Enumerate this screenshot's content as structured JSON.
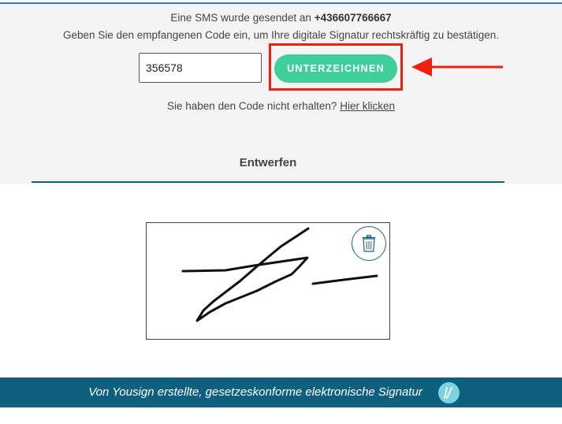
{
  "sms": {
    "sent_prefix": "Eine SMS wurde gesendet an",
    "phone": "+436607766667",
    "instruction": "Geben Sie den empfangenen Code ein, um Ihre digitale Signatur rechtskräftig zu bestätigen.",
    "code_value": "356578",
    "sign_button_label": "UNTERZEICHNEN",
    "resend_prefix": "Sie haben den Code nicht erhalten?",
    "resend_link": "Hier klicken"
  },
  "tabs": {
    "draw_label": "Entwerfen"
  },
  "signature_pad": {
    "clear_icon": "trash-icon"
  },
  "footer": {
    "text": "Von Yousign erstellte, gesetzeskonforme elektronische Signatur",
    "logo_icon": "yousign-logo-icon"
  },
  "colors": {
    "accent_green": "#3fcf9a",
    "footer_blue": "#0f5f7e",
    "highlight_red": "#f01f0f",
    "panel_gray": "#f4f4f4"
  }
}
